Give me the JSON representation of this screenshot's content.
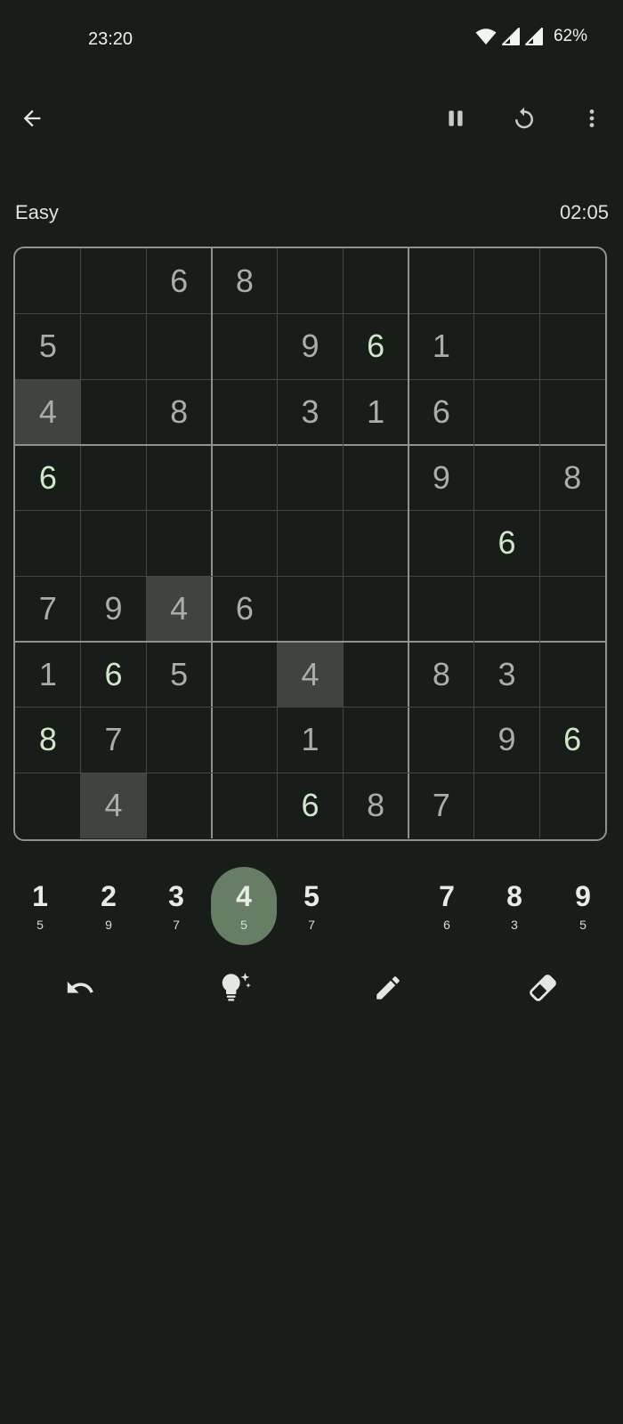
{
  "status": {
    "time": "23:20",
    "battery": "62%",
    "icons": [
      "wifi-icon",
      "signal-icon",
      "signal-icon",
      "battery-level"
    ]
  },
  "appbar": {
    "icons": [
      "back-arrow-icon",
      "pause-icon",
      "restart-icon",
      "more-vert-icon"
    ]
  },
  "game": {
    "difficulty": "Easy",
    "timer": "02:05"
  },
  "board": {
    "given_color": "#a9aea8",
    "user_color": "#cfe8c7",
    "highlight_color": "#3f443f",
    "rows": [
      [
        {
          "v": ""
        },
        {
          "v": ""
        },
        {
          "v": "6"
        },
        {
          "v": "8"
        },
        {
          "v": ""
        },
        {
          "v": ""
        },
        {
          "v": ""
        },
        {
          "v": ""
        },
        {
          "v": ""
        }
      ],
      [
        {
          "v": "5"
        },
        {
          "v": ""
        },
        {
          "v": ""
        },
        {
          "v": ""
        },
        {
          "v": "9"
        },
        {
          "v": "6",
          "user": true
        },
        {
          "v": "1"
        },
        {
          "v": ""
        },
        {
          "v": ""
        }
      ],
      [
        {
          "v": "4",
          "hl": true
        },
        {
          "v": ""
        },
        {
          "v": "8"
        },
        {
          "v": ""
        },
        {
          "v": "3"
        },
        {
          "v": "1"
        },
        {
          "v": "6"
        },
        {
          "v": ""
        },
        {
          "v": ""
        }
      ],
      [
        {
          "v": "6",
          "user": true
        },
        {
          "v": ""
        },
        {
          "v": ""
        },
        {
          "v": ""
        },
        {
          "v": ""
        },
        {
          "v": ""
        },
        {
          "v": "9"
        },
        {
          "v": ""
        },
        {
          "v": "8"
        }
      ],
      [
        {
          "v": ""
        },
        {
          "v": ""
        },
        {
          "v": ""
        },
        {
          "v": ""
        },
        {
          "v": ""
        },
        {
          "v": ""
        },
        {
          "v": ""
        },
        {
          "v": "6",
          "user": true
        },
        {
          "v": ""
        }
      ],
      [
        {
          "v": "7"
        },
        {
          "v": "9"
        },
        {
          "v": "4",
          "hl": true
        },
        {
          "v": "6"
        },
        {
          "v": ""
        },
        {
          "v": ""
        },
        {
          "v": ""
        },
        {
          "v": ""
        },
        {
          "v": ""
        }
      ],
      [
        {
          "v": "1"
        },
        {
          "v": "6",
          "user": true
        },
        {
          "v": "5"
        },
        {
          "v": ""
        },
        {
          "v": "4",
          "hl": true
        },
        {
          "v": ""
        },
        {
          "v": "8"
        },
        {
          "v": "3"
        },
        {
          "v": ""
        }
      ],
      [
        {
          "v": "8",
          "user": true
        },
        {
          "v": "7"
        },
        {
          "v": ""
        },
        {
          "v": ""
        },
        {
          "v": "1"
        },
        {
          "v": ""
        },
        {
          "v": ""
        },
        {
          "v": "9"
        },
        {
          "v": "6",
          "user": true
        }
      ],
      [
        {
          "v": ""
        },
        {
          "v": "4",
          "hl": true
        },
        {
          "v": ""
        },
        {
          "v": ""
        },
        {
          "v": "6",
          "user": true
        },
        {
          "v": "8"
        },
        {
          "v": "7"
        },
        {
          "v": ""
        },
        {
          "v": ""
        }
      ]
    ]
  },
  "numpad": {
    "selected": "4",
    "selected_color": "#677d66",
    "buttons": [
      {
        "digit": "1",
        "count": "5"
      },
      {
        "digit": "2",
        "count": "9"
      },
      {
        "digit": "3",
        "count": "7"
      },
      {
        "digit": "4",
        "count": "5"
      },
      {
        "digit": "5",
        "count": "7"
      },
      {
        "digit": "",
        "count": ""
      },
      {
        "digit": "7",
        "count": "6"
      },
      {
        "digit": "8",
        "count": "3"
      },
      {
        "digit": "9",
        "count": "5"
      }
    ]
  },
  "tools": [
    "undo-icon",
    "hint-bulb-icon",
    "pencil-icon",
    "eraser-icon"
  ]
}
